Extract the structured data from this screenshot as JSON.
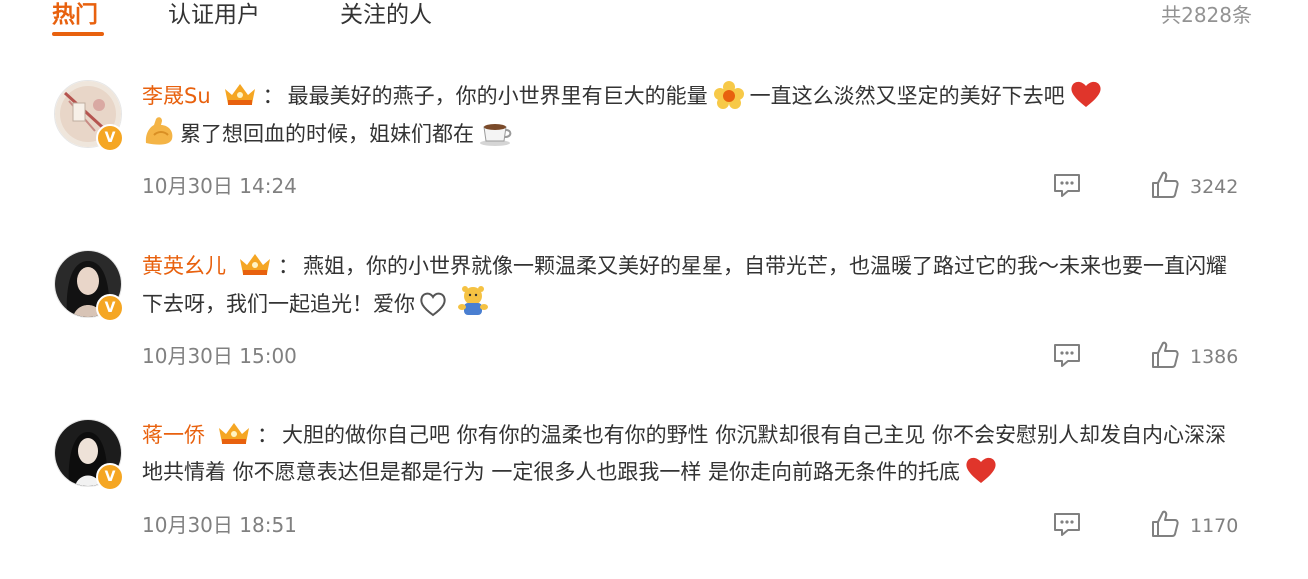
{
  "tabs": {
    "hot": "热门",
    "verified": "认证用户",
    "following": "关注的人",
    "total": "共2828条"
  },
  "colors": {
    "accent": "#e8610e",
    "muted": "#808080",
    "badge": "#f5a623"
  },
  "comments": [
    {
      "username": "李晟Su",
      "colon": "：",
      "text_a": "最最美好的燕子，你的小世界里有巨大的能量",
      "emoji_a": "yellow-flower-icon",
      "text_b": "一直这么淡然又坚定的美好下去吧",
      "emoji_b": "red-heart-icon",
      "emoji_c": "flexed-biceps-icon",
      "text_c": "累了想回血的时候，姐妹们都在",
      "emoji_d": "coffee-cup-icon",
      "time": "10月30日 14:24",
      "likes": "3242"
    },
    {
      "username": "黄英幺儿",
      "colon": "：",
      "text_a": "燕姐，你的小世界就像一颗温柔又美好的星星，自带光芒，也温暖了路过它的我～未来也要一直闪耀下去呀，我们一起追光！爱你",
      "emoji_a": "outline-heart-icon",
      "emoji_b": "hugging-bear-icon",
      "time": "10月30日 15:00",
      "likes": "1386"
    },
    {
      "username": "蒋一侨",
      "colon": "：",
      "text_a": "大胆的做你自己吧 你有你的温柔也有你的野性 你沉默却很有自己主见 你不会安慰别人却发自内心深深地共情着 你不愿意表达但是都是行为 一定很多人也跟我一样 是你走向前路无条件的托底",
      "emoji_a": "red-heart-icon",
      "time": "10月30日 18:51",
      "likes": "1170"
    }
  ]
}
